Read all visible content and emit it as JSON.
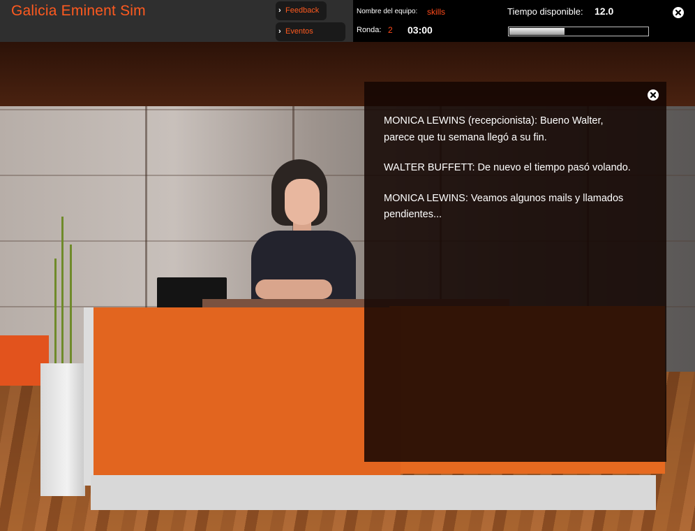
{
  "app": {
    "title": "Galicia Eminent Sim"
  },
  "nav": {
    "feedback_label": "Feedback",
    "previous_events_label": "Eventos Previos"
  },
  "status": {
    "team_label": "Nombre del equipo:",
    "team_value": "skills",
    "round_label": "Ronda:",
    "round_value": "2",
    "time": "03:00",
    "available_label": "Tiempo disponible:",
    "available_value": "12.0",
    "available_progress_fraction": 0.4
  },
  "dialog": {
    "lines": [
      "MONICA LEWINS (recepcionista): Bueno Walter, parece que tu semana llegó a su fin.",
      "WALTER BUFFETT: De nuevo el tiempo pasó volando.",
      "MONICA LEWINS: Veamos algunos mails y llamados pendientes..."
    ]
  },
  "colors": {
    "accent": "#ff5a1f",
    "topbar": "#2f2f2f",
    "panel": "#000000",
    "desk": "#e2651f"
  },
  "icons": {
    "close": "close-icon",
    "chevron": "chevron-right-icon"
  }
}
